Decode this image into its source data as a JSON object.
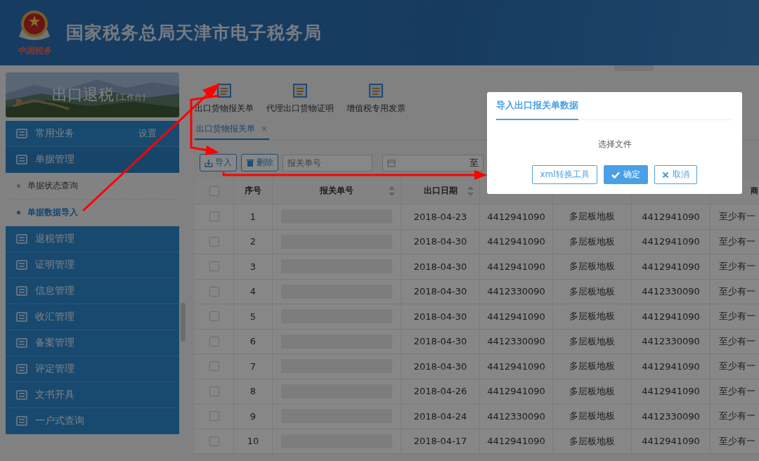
{
  "header": {
    "title": "国家税务总局天津市电子税务局",
    "logo_text": "中国税务"
  },
  "sidebar": {
    "banner": {
      "title": "出口退税",
      "subtitle": "[工作台]"
    },
    "menu": [
      {
        "label": "常用业务",
        "extra": "设置",
        "expanded": false
      },
      {
        "label": "单据管理",
        "expanded": true,
        "children": [
          {
            "label": "单据状态查询",
            "selected": false
          },
          {
            "label": "单据数据导入",
            "selected": true
          }
        ]
      },
      {
        "label": "退税管理",
        "expanded": false
      },
      {
        "label": "证明管理",
        "expanded": false
      },
      {
        "label": "信息管理",
        "expanded": false
      },
      {
        "label": "收汇管理",
        "expanded": false
      },
      {
        "label": "备案管理",
        "expanded": false
      },
      {
        "label": "评定管理",
        "expanded": false
      },
      {
        "label": "文书开具",
        "expanded": false
      },
      {
        "label": "一户式查询",
        "expanded": false
      }
    ]
  },
  "toolbar": [
    {
      "label": "出口货物报关单"
    },
    {
      "label": "代理出口货物证明"
    },
    {
      "label": "增值税专用发票"
    }
  ],
  "tabs": [
    {
      "label": "出口货物报关单",
      "selected": true,
      "close": "×"
    }
  ],
  "actions": {
    "import": "导入",
    "delete": "删除",
    "search_placeholder": "报关单号",
    "date_separator": "至"
  },
  "table": {
    "select_all_checked": false,
    "columns": [
      {
        "kind": "checkbox"
      },
      {
        "kind": "text",
        "label": "序号"
      },
      {
        "kind": "sort",
        "label": "报关单号"
      },
      {
        "kind": "sort",
        "label": "出口日期"
      },
      {
        "kind": "covered"
      },
      {
        "kind": "covered"
      },
      {
        "kind": "covered"
      },
      {
        "kind": "edge",
        "label": "商"
      }
    ],
    "rows": [
      {
        "checked": false,
        "no": "1",
        "date": "2018-04-23",
        "code": "4412941090",
        "name": "多层板地板",
        "code2": "4412941090",
        "note": "至少有一"
      },
      {
        "checked": false,
        "no": "2",
        "date": "2018-04-30",
        "code": "4412941090",
        "name": "多层板地板",
        "code2": "4412941090",
        "note": "至少有一"
      },
      {
        "checked": false,
        "no": "3",
        "date": "2018-04-30",
        "code": "4412941090",
        "name": "多层板地板",
        "code2": "4412941090",
        "note": "至少有一"
      },
      {
        "checked": false,
        "no": "4",
        "date": "2018-04-30",
        "code": "4412330090",
        "name": "多层板地板",
        "code2": "4412330090",
        "note": "至少有一"
      },
      {
        "checked": false,
        "no": "5",
        "date": "2018-04-30",
        "code": "4412941090",
        "name": "多层板地板",
        "code2": "4412941090",
        "note": "至少有一"
      },
      {
        "checked": false,
        "no": "6",
        "date": "2018-04-30",
        "code": "4412330090",
        "name": "多层板地板",
        "code2": "4412330090",
        "note": "至少有一"
      },
      {
        "checked": false,
        "no": "7",
        "date": "2018-04-30",
        "code": "4412941090",
        "name": "多层板地板",
        "code2": "4412941090",
        "note": "至少有一"
      },
      {
        "checked": false,
        "no": "8",
        "date": "2018-04-26",
        "code": "4412941090",
        "name": "多层板地板",
        "code2": "4412941090",
        "note": "至少有一"
      },
      {
        "checked": false,
        "no": "9",
        "date": "2018-04-24",
        "code": "4412330090",
        "name": "多层板地板",
        "code2": "4412330090",
        "note": "至少有一"
      },
      {
        "checked": false,
        "no": "10",
        "date": "2018-04-17",
        "code": "4412941090",
        "name": "多层板地板",
        "code2": "4412941090",
        "note": "至少有一"
      }
    ]
  },
  "dialog": {
    "title": "导入出口报关单数据",
    "file_label": "选择文件",
    "buttons": [
      {
        "kind": "outline",
        "label": "xml转换工具"
      },
      {
        "kind": "primary",
        "label": "确定"
      },
      {
        "kind": "cancel",
        "label": "取消"
      }
    ]
  }
}
